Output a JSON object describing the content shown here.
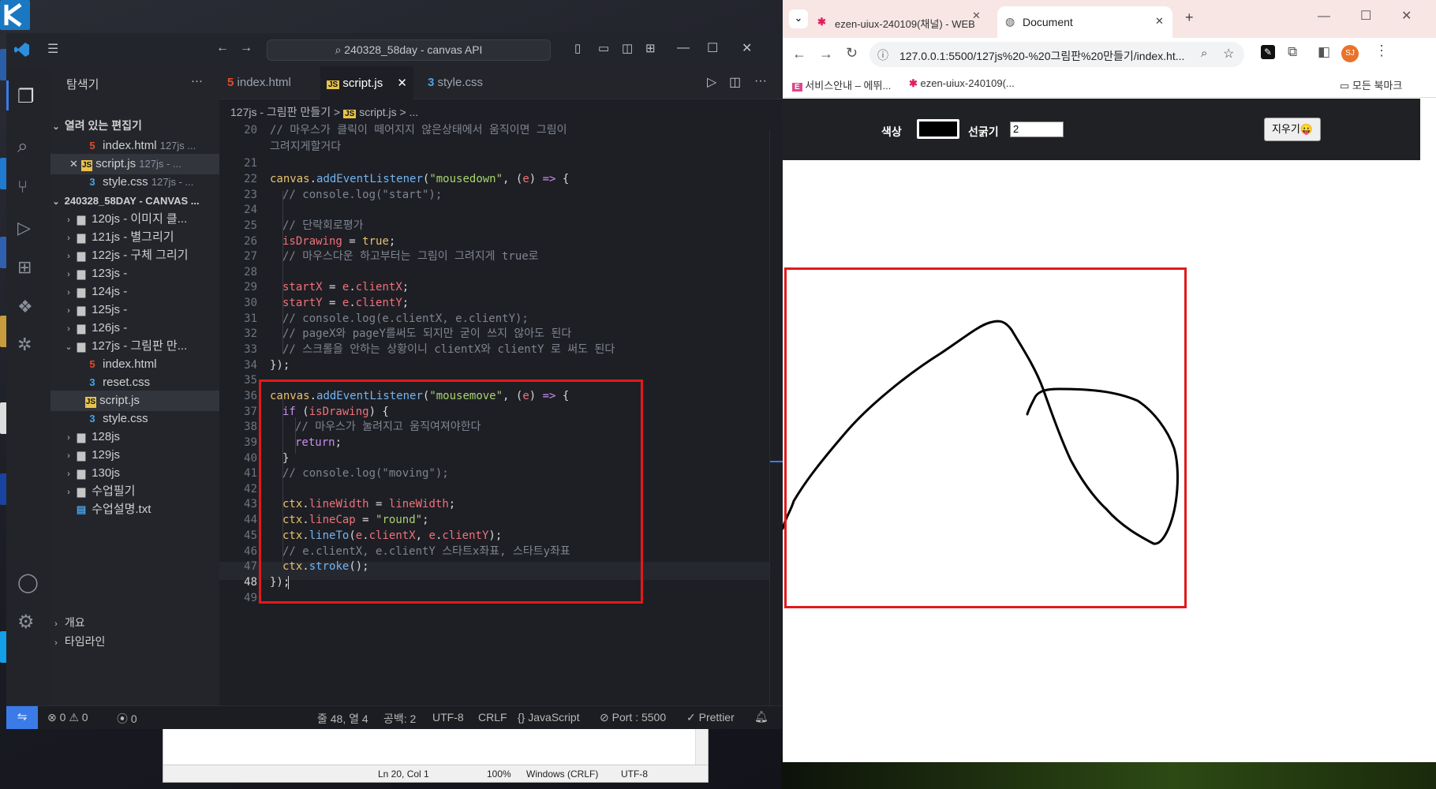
{
  "vscode": {
    "search_text": "240328_58day - canvas API",
    "tabs": [
      {
        "label": "index.html"
      },
      {
        "label": "script.js"
      },
      {
        "label": "style.css"
      }
    ],
    "breadcrumb": {
      "folder": "127js - 그림판 만들기",
      "sep": ">",
      "file": "script.js",
      "rest": "> ..."
    },
    "explorer": {
      "title": "탐색기",
      "more": "···",
      "open_editors_label": "열려 있는 편집기",
      "open_editors": [
        {
          "name": "index.html",
          "path": "127js ..."
        },
        {
          "name": "script.js",
          "path": "127js - ..."
        },
        {
          "name": "style.css",
          "path": "127js - ..."
        }
      ],
      "workspace_label": "240328_58DAY - CANVAS ...",
      "items": [
        "120js - 이미지 클...",
        "121js - 별그리기",
        "122js - 구체 그리기",
        "123js -",
        "124js -",
        "125js -",
        "126js -",
        "127js - 그림판 만...",
        "index.html",
        "reset.css",
        "script.js",
        "style.css",
        "128js",
        "129js",
        "130js",
        "수업필기",
        "수업설명.txt"
      ],
      "outline_label": "개요",
      "timeline_label": "타임라인"
    },
    "code": {
      "l20a": "// 마우스가 클릭이 떼어지지 않은상태에서 움직이면 그림이",
      "l20b": "그려지게할거다",
      "l22a": "canvas",
      "l22b": ".",
      "l22c": "addEventListener",
      "l22d": "(",
      "l22e": "\"mousedown\"",
      "l22f": ", (",
      "l22g": "e",
      "l22h": ") ",
      "l22i": "=>",
      "l22j": " {",
      "l23": "// console.log(\"start\");",
      "l25": "// 단락회로평가",
      "l26a": "isDrawing",
      "l26b": " = ",
      "l26c": "true",
      "l26d": ";",
      "l27": "// 마우스다운 하고부터는 그림이 그려지게 true로",
      "l29a": "startX",
      "l29b": " = ",
      "l29c": "e",
      "l29d": ".",
      "l29e": "clientX",
      "l29f": ";",
      "l30a": "startY",
      "l30b": " = ",
      "l30c": "e",
      "l30d": ".",
      "l30e": "clientY",
      "l30f": ";",
      "l31": "// console.log(e.clientX, e.clientY);",
      "l32": "// pageX와 pageY를써도 되지만 굳이 쓰지 않아도 된다",
      "l33": "// 스크롤을 안하는 상황이니 clientX와 clientY 로 써도 된다",
      "l34": "});",
      "l36e": "\"mousemove\"",
      "l37a": "if",
      "l37b": " (",
      "l37c": "isDrawing",
      "l37d": ") {",
      "l38": "// 마우스가 눌려지고 움직여져야한다",
      "l39a": "return",
      "l39b": ";",
      "l40": "}",
      "l41": "// console.log(\"moving\");",
      "l43a": "ctx",
      "l43b": ".",
      "l43c": "lineWidth",
      "l43d": " = ",
      "l43e": "lineWidth",
      "l43f": ";",
      "l44a": "ctx",
      "l44b": ".",
      "l44c": "lineCap",
      "l44d": " = ",
      "l44e": "\"round\"",
      "l44f": ";",
      "l45a": "ctx",
      "l45b": ".",
      "l45c": "lineTo",
      "l45d": "(",
      "l45e": "e",
      "l45f": ".",
      "l45g": "clientX",
      "l45h": ", ",
      "l45i": "e",
      "l45j": ".",
      "l45k": "clientY",
      "l45l": ");",
      "l46": "// e.clientX, e.clientY 스타트x좌표, 스타트y좌표",
      "l47a": "ctx",
      "l47b": ".",
      "l47c": "stroke",
      "l47d": "();",
      "l48": "});"
    },
    "line_numbers": [
      "20",
      "21",
      "22",
      "23",
      "24",
      "25",
      "26",
      "27",
      "28",
      "29",
      "30",
      "31",
      "32",
      "33",
      "34",
      "35",
      "36",
      "37",
      "38",
      "39",
      "40",
      "41",
      "42",
      "43",
      "44",
      "45",
      "46",
      "47",
      "48",
      "49"
    ],
    "status": {
      "errors": "0",
      "warnings": "0",
      "ports": "0",
      "position": "줄 48, 열 4",
      "spaces": "공백: 2",
      "encoding": "UTF-8",
      "eol": "CRLF",
      "language": "JavaScript",
      "port": "Port : 5500",
      "prettier": "Prettier"
    }
  },
  "notepad": {
    "position": "Ln 20, Col 1",
    "zoom": "100%",
    "eol": "Windows (CRLF)",
    "encoding": "UTF-8"
  },
  "browser": {
    "tabs": [
      {
        "label": "ezen-uiux-240109(채널) - WEB"
      },
      {
        "label": "Document"
      }
    ],
    "url": "127.0.0.1:5500/127js%20-%20그림판%20만들기/index.ht...",
    "profile_initials": "SJ",
    "bookmarks": [
      {
        "label": "서비스안내 – 에뛰..."
      },
      {
        "label": "ezen-uiux-240109(..."
      }
    ],
    "all_bookmarks": "모든 북마크",
    "page": {
      "color_label": "색상",
      "width_label": "선굵기",
      "width_value": "2",
      "clear_button": "지우기😛"
    }
  },
  "colors": {
    "highlight": "#e11a1a",
    "accent": "#3b7be8"
  }
}
